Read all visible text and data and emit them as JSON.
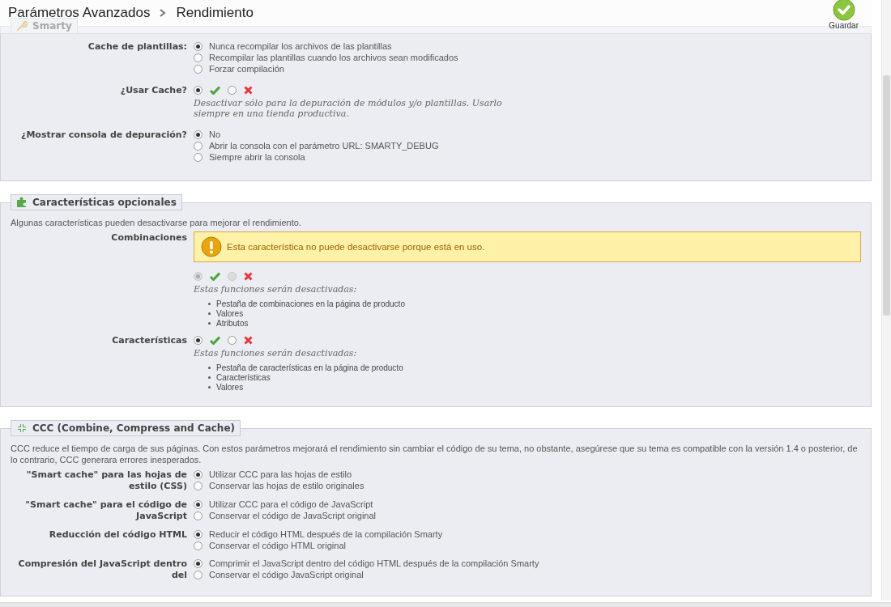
{
  "breadcrumb": [
    "Parámetros Avanzados",
    "Rendimiento"
  ],
  "save_button": {
    "label": "Guardar"
  },
  "sections": [
    {
      "legend": "Smarty",
      "fields": [
        {
          "kind": "radio",
          "label": "Cache de plantillas:",
          "options": [
            {
              "label": "Nunca recompilar los archivos de las plantillas",
              "selected": true
            },
            {
              "label": "Recompilar las plantillas cuando los archivos sean modificados",
              "selected": false
            },
            {
              "label": "Forzar compilación",
              "selected": false
            }
          ]
        },
        {
          "kind": "toggle",
          "label": "¿Usar Cache?",
          "on": true,
          "disabled": false,
          "hint": "Desactivar sólo para la depuración de módulos y/o plantillas. Usarlo siempre en una tienda productiva."
        },
        {
          "kind": "radio",
          "label": "¿Mostrar consola de depuración?",
          "options": [
            {
              "label": "No",
              "selected": true
            },
            {
              "label": "Abrir la consola con el parámetro URL: SMARTY_DEBUG",
              "selected": false
            },
            {
              "label": "Siempre abrir la consola",
              "selected": false
            }
          ]
        }
      ]
    },
    {
      "legend": "Características opcionales",
      "intro": "Algunas características pueden desactivarse para mejorar el rendimiento.",
      "fields": [
        {
          "kind": "toggle",
          "label": "Combinaciones",
          "warning": "Esta característica no puede desactivarse porque está en uso.",
          "on": true,
          "disabled": true,
          "hint": "Estas funciones serán desactivadas:",
          "items": [
            "Pestaña de combinaciones en la página de producto",
            "Valores",
            "Atributos"
          ]
        },
        {
          "kind": "toggle",
          "label": "Características",
          "on": true,
          "disabled": false,
          "hint": "Estas funciones serán desactivadas:",
          "items": [
            "Pestaña de características en la página de producto",
            "Características",
            "Valores"
          ]
        }
      ]
    },
    {
      "legend": "CCC (Combine, Compress and Cache)",
      "intro": "CCC reduce el tiempo de carga de sus páginas. Con estos parámetros mejorará el rendimiento sin cambiar el código de su tema, no obstante, asegúrese que su tema es compatible con la versión 1.4 o posterior, de lo contrario, CCC generara errores inesperados.",
      "fields": [
        {
          "kind": "radio",
          "label": "\"Smart cache\" para las hojas de estilo (CSS)",
          "options": [
            {
              "label": "Utilizar CCC para las hojas de estilo",
              "selected": true
            },
            {
              "label": "Conservar las hojas de estilo originales",
              "selected": false
            }
          ]
        },
        {
          "kind": "radio",
          "label": "\"Smart cache\" para el código de JavaScript",
          "options": [
            {
              "label": "Utilizar CCC para el código de JavaScript",
              "selected": true
            },
            {
              "label": "Conservar el código de JavaScript original",
              "selected": false
            }
          ]
        },
        {
          "kind": "radio",
          "label": "Reducción del código HTML",
          "options": [
            {
              "label": "Reducir el código HTML después de la compilación Smarty",
              "selected": true
            },
            {
              "label": "Conservar el código HTML original",
              "selected": false
            }
          ]
        },
        {
          "kind": "radio",
          "label": "Compresión del JavaScript dentro del",
          "options": [
            {
              "label": "Comprimir el JavaScript dentro del código HTML después de la compilación Smarty",
              "selected": true
            },
            {
              "label": "Conservar el código JavaScript original",
              "selected": false
            }
          ]
        }
      ]
    }
  ]
}
